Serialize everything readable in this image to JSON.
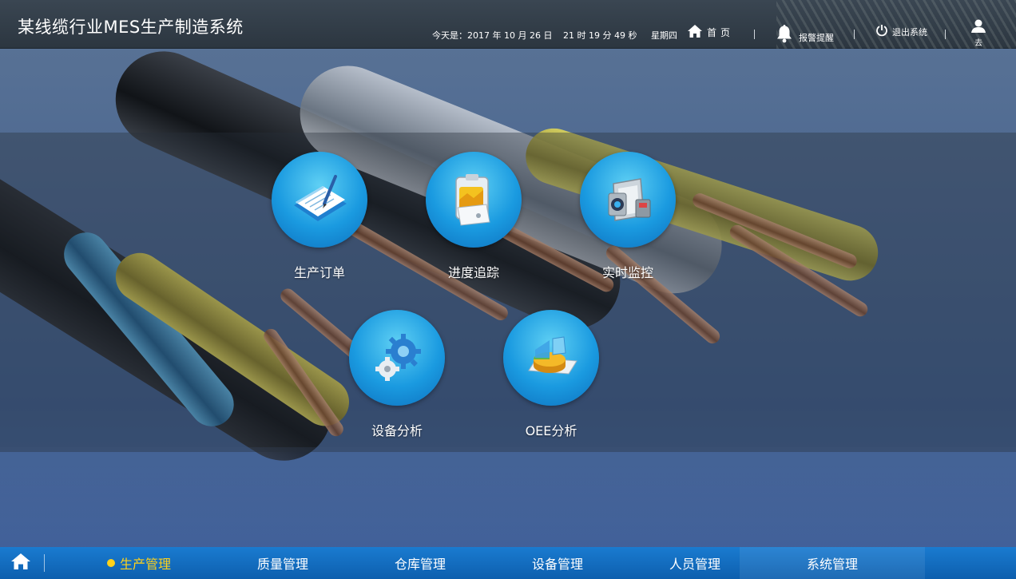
{
  "header": {
    "title": "某线缆行业MES生产制造系统",
    "date_prefix": "今天是：",
    "date": "2017 年 10 月 26 日",
    "time": "21 时 19 分 49 秒",
    "weekday": "星期四",
    "home_label": "首页",
    "alarm_label": "报警提醒",
    "logout_label": "退出系统",
    "user_name": "去"
  },
  "tiles": [
    {
      "label": "生产订单",
      "icon": "order-document-icon"
    },
    {
      "label": "进度追踪",
      "icon": "progress-tracking-icon"
    },
    {
      "label": "实时监控",
      "icon": "surveillance-camera-icon"
    },
    {
      "label": "设备分析",
      "icon": "gears-icon"
    },
    {
      "label": "OEE分析",
      "icon": "pie-chart-icon"
    }
  ],
  "nav": {
    "items": [
      {
        "label": "生产管理",
        "active": true
      },
      {
        "label": "质量管理",
        "active": false
      },
      {
        "label": "仓库管理",
        "active": false
      },
      {
        "label": "设备管理",
        "active": false
      },
      {
        "label": "人员管理",
        "active": false
      },
      {
        "label": "系统管理",
        "active": false
      }
    ]
  },
  "colors": {
    "topbar": "#2f3a45",
    "nav_bar": "#1470c4",
    "active_nav": "#ffd21a",
    "tile_circle": "#1a9ae0"
  }
}
